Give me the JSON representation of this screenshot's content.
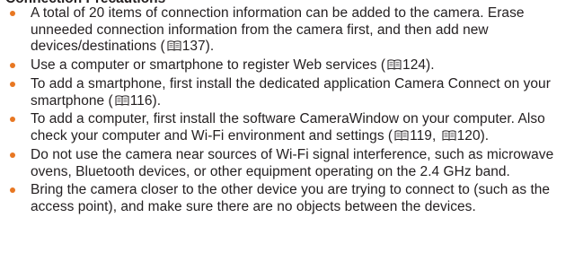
{
  "heading_partial": "Connection Precautions",
  "book_icon": "book-reference-icon",
  "accent_color": "#e87722",
  "text_color": "#231f20",
  "items": [
    {
      "segments": [
        {
          "text": "A total of 20 items of connection information can be added to the camera. Erase unneeded connection information from the camera first, and then add new devices/destinations ("
        },
        {
          "ref": "137"
        },
        {
          "text": ")."
        }
      ]
    },
    {
      "segments": [
        {
          "text": "Use a computer or smartphone to register Web services ("
        },
        {
          "ref": "124"
        },
        {
          "text": ")."
        }
      ]
    },
    {
      "segments": [
        {
          "text": "To add a smartphone, first install the dedicated application Camera Connect on your smartphone ("
        },
        {
          "ref": "116"
        },
        {
          "text": ")."
        }
      ]
    },
    {
      "segments": [
        {
          "text": "To add a computer, first install the software CameraWindow on your computer. Also check your computer and Wi-Fi environment and settings ("
        },
        {
          "ref": "119"
        },
        {
          "text": ", "
        },
        {
          "ref": "120"
        },
        {
          "text": ")."
        }
      ]
    },
    {
      "segments": [
        {
          "text": "Do not use the camera near sources of Wi-Fi signal interference, such as microwave ovens, Bluetooth devices, or other equipment operating on the 2.4 GHz band."
        }
      ]
    },
    {
      "segments": [
        {
          "text": "Bring the camera closer to the other device you are trying to connect to (such as the access point), and make sure there are no objects between the devices."
        }
      ]
    }
  ]
}
